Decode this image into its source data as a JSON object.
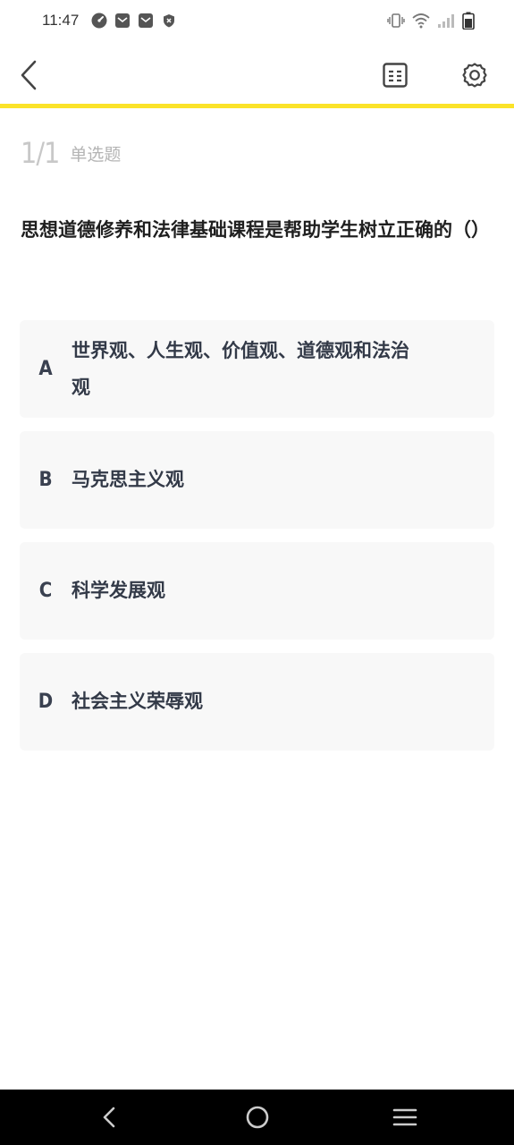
{
  "status_bar": {
    "time": "11:47",
    "left_icons": [
      "speedometer-icon",
      "mail-icon",
      "mail-icon",
      "shield-icon"
    ],
    "right_icons": [
      "vibrate-icon",
      "wifi-icon",
      "signal-icon",
      "battery-icon"
    ]
  },
  "toolbar": {
    "back_icon": "chevron-left-icon",
    "answer_card_icon": "answer-card-icon",
    "settings_icon": "gear-icon",
    "accent_color": "#fbe329"
  },
  "question": {
    "progress": "1/1",
    "type": "单选题",
    "text": "思想道德修养和法律基础课程是帮助学生树立正确的（）"
  },
  "options": [
    {
      "letter": "A",
      "text": "世界观、人生观、价值观、道德观和法治观"
    },
    {
      "letter": "B",
      "text": "马克思主义观"
    },
    {
      "letter": "C",
      "text": "科学发展观"
    },
    {
      "letter": "D",
      "text": "社会主义荣辱观"
    }
  ],
  "nav_bar": {
    "icons": [
      "nav-back-icon",
      "nav-home-icon",
      "nav-recents-icon"
    ]
  }
}
